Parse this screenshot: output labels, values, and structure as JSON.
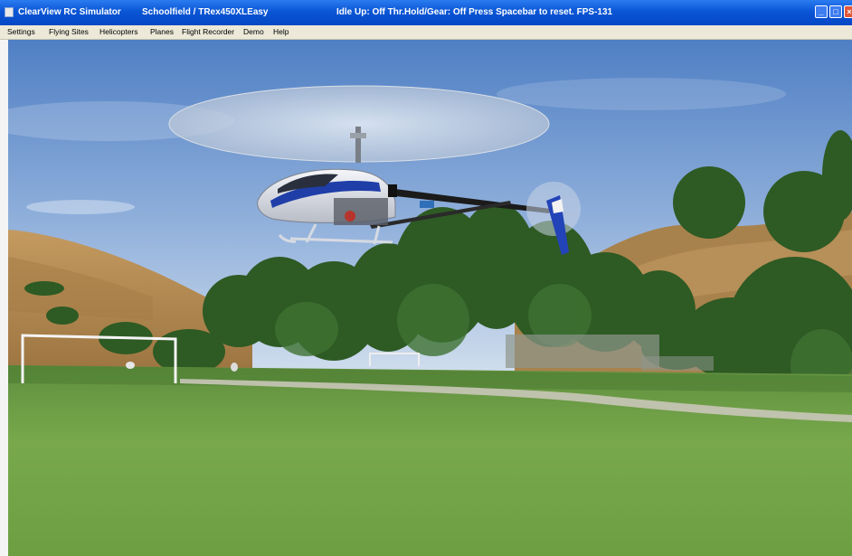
{
  "window": {
    "title_app": "ClearView RC Simulator",
    "title_site": "Schoolfield / TRex450XLEasy",
    "title_status": "Idle Up: Off  Thr.Hold/Gear: Off Press Spacebar to reset.  FPS-131",
    "controls": {
      "minimize": "_",
      "maximize": "□",
      "close": "×"
    }
  },
  "menu": {
    "items": [
      "Settings",
      "Flying Sites",
      "Helicopters",
      "Planes",
      "Flight Recorder",
      "Demo",
      "Help"
    ]
  },
  "scene": {
    "description_icon": "helicopter-3d-model",
    "colors": {
      "sky_top": "#5b86c9",
      "sky_bottom": "#c9d8ea",
      "grass": "#6fa048",
      "trees": "#2f5a25",
      "hill": "#b8894f",
      "heli_blue": "#1f3ea8"
    }
  }
}
